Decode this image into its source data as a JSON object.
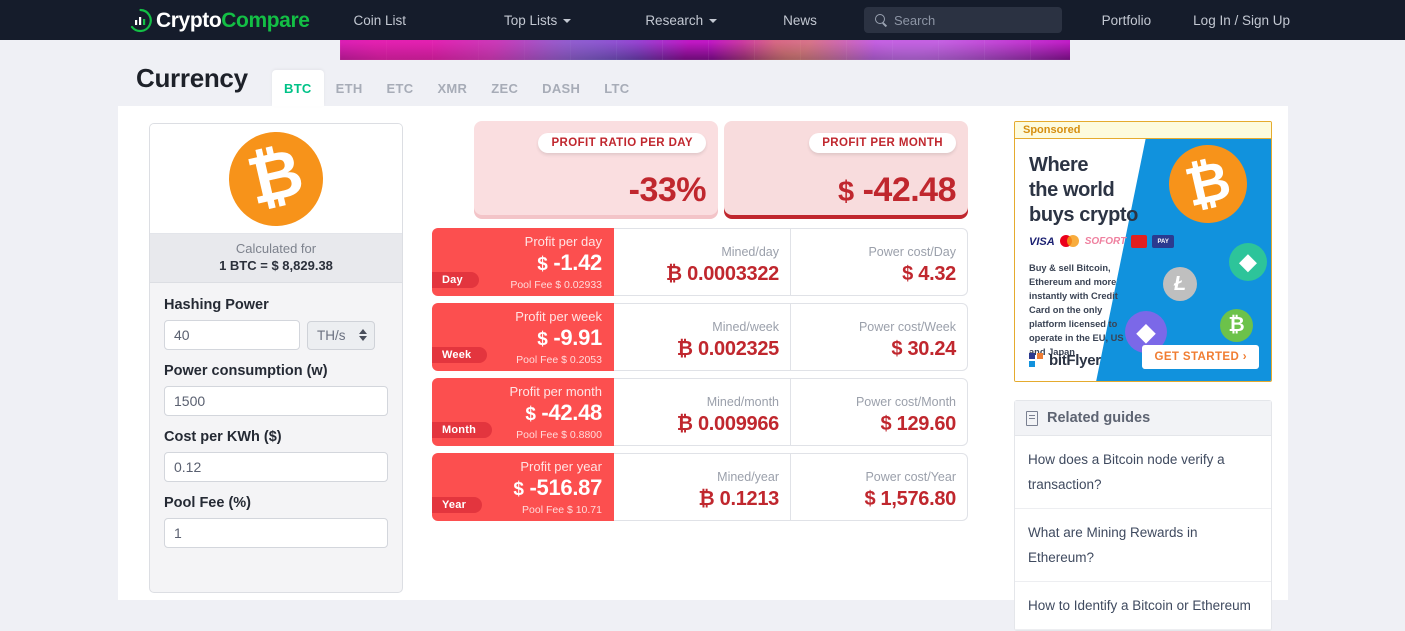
{
  "nav": {
    "logo": {
      "part1": "Crypto",
      "part2": "Compare",
      "icon": "chart-circle-icon"
    },
    "items": [
      {
        "label": "Coin List",
        "caret": false
      },
      {
        "label": "Top Lists",
        "caret": true
      },
      {
        "label": "Research",
        "caret": true
      },
      {
        "label": "News",
        "caret": false
      }
    ],
    "search": {
      "placeholder": "Search",
      "value": "",
      "icon": "search-icon"
    },
    "right": [
      {
        "label": "Portfolio"
      },
      {
        "label": "Log In / Sign Up"
      }
    ]
  },
  "currency": {
    "title": "Currency",
    "tabs": [
      {
        "label": "BTC",
        "active": true
      },
      {
        "label": "ETH",
        "active": false
      },
      {
        "label": "ETC",
        "active": false
      },
      {
        "label": "XMR",
        "active": false
      },
      {
        "label": "ZEC",
        "active": false
      },
      {
        "label": "DASH",
        "active": false
      },
      {
        "label": "LTC",
        "active": false
      }
    ]
  },
  "form": {
    "coin_symbol": "₿",
    "calculated_for_label": "Calculated for",
    "calculated_for_value": "1 BTC = $ 8,829.38",
    "fields": [
      {
        "label": "Hashing Power",
        "value": "40",
        "unit": "TH/s"
      },
      {
        "label": "Power consumption (w)",
        "value": "1500"
      },
      {
        "label": "Cost per KWh ($)",
        "value": "0.12"
      },
      {
        "label": "Pool Fee (%)",
        "value": "1"
      }
    ]
  },
  "summary": [
    {
      "badge": "PROFIT RATIO PER DAY",
      "currency": "",
      "value": "-33%"
    },
    {
      "badge": "PROFIT PER MONTH",
      "currency": "$",
      "value": "-42.48"
    }
  ],
  "results": {
    "rows": [
      {
        "period": "Day",
        "profit_label": "Profit per day",
        "profit_currency": "$",
        "profit_value": "-1.42",
        "pool_fee": "Pool Fee $ 0.02933",
        "mined_label": "Mined/day",
        "mined_symbol": "₿",
        "mined_value": "0.0003322",
        "power_label": "Power cost/Day",
        "power_currency": "$",
        "power_value": "4.32"
      },
      {
        "period": "Week",
        "profit_label": "Profit per week",
        "profit_currency": "$",
        "profit_value": "-9.91",
        "pool_fee": "Pool Fee $ 0.2053",
        "mined_label": "Mined/week",
        "mined_symbol": "₿",
        "mined_value": "0.002325",
        "power_label": "Power cost/Week",
        "power_currency": "$",
        "power_value": "30.24"
      },
      {
        "period": "Month",
        "profit_label": "Profit per month",
        "profit_currency": "$",
        "profit_value": "-42.48",
        "pool_fee": "Pool Fee $ 0.8800",
        "mined_label": "Mined/month",
        "mined_symbol": "₿",
        "mined_value": "0.009966",
        "power_label": "Power cost/Month",
        "power_currency": "$",
        "power_value": "129.60"
      },
      {
        "period": "Year",
        "profit_label": "Profit per year",
        "profit_currency": "$",
        "profit_value": "-516.87",
        "pool_fee": "Pool Fee $ 10.71",
        "mined_label": "Mined/year",
        "mined_symbol": "₿",
        "mined_value": "0.1213",
        "power_label": "Power cost/Year",
        "power_currency": "$",
        "power_value": "1,576.80"
      }
    ]
  },
  "ad": {
    "sponsored_label": "Sponsored",
    "headline": "Where\nthe world\nbuys crypto",
    "payment_methods": [
      "VISA",
      "mastercard",
      "SOFORT",
      "card-1",
      "card-2"
    ],
    "body": "Buy & sell Bitcoin, Ethereum and more instantly with Credit Card on the only platform licensed to operate in the EU, US and Japan",
    "brand": "bitFlyer",
    "cta": "GET STARTED ›"
  },
  "guides": {
    "title": "Related guides",
    "items": [
      {
        "label": "How does a Bitcoin node verify a transaction?"
      },
      {
        "label": "What are Mining Rewards in Ethereum?"
      },
      {
        "label": "How to Identify a Bitcoin or Ethereum"
      }
    ]
  },
  "colors": {
    "nav_bg": "#151c2b",
    "accent_green": "#13bf45",
    "tab_active": "#00c287",
    "btc_orange": "#f7931a",
    "red_row": "#fc4f4f",
    "red_dark": "#c0272e",
    "page_bg": "#eff0f5"
  }
}
